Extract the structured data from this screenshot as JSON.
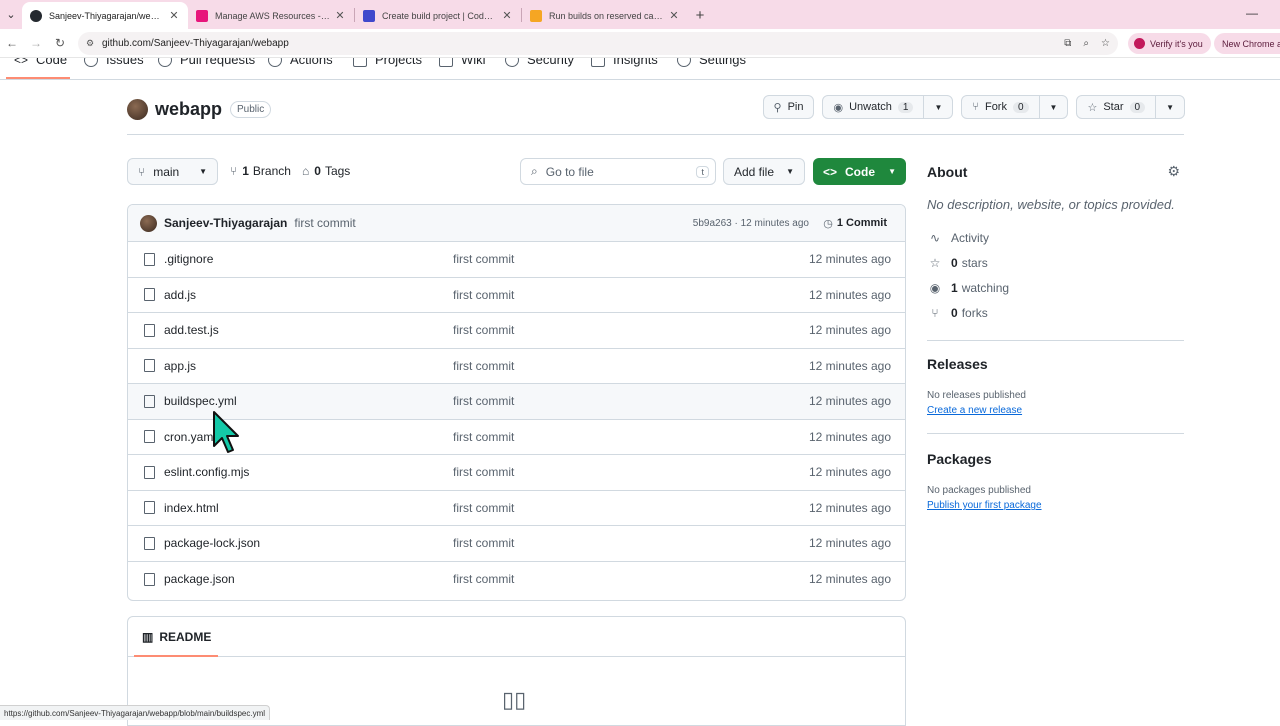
{
  "browser": {
    "tabs": [
      {
        "title": "Sanjeev-Thiyagarajan/webapp",
        "favicon": "github-icon",
        "color": "#24292f"
      },
      {
        "title": "Manage AWS Resources - AWS",
        "favicon": "aws-cube-icon",
        "color": "#e7157b"
      },
      {
        "title": "Create build project | CodeBuild",
        "favicon": "codebuild-icon",
        "color": "#3f48cc"
      },
      {
        "title": "Run builds on reserved capacity",
        "favicon": "aws-docs-icon",
        "color": "#f5a623"
      }
    ],
    "url": "github.com/Sanjeev-Thiyagarajan/webapp",
    "verify_label": "Verify it's you",
    "new_chrome_label": "New Chrome av",
    "status_url": "https://github.com/Sanjeev-Thiyagarajan/webapp/blob/main/buildspec.yml"
  },
  "repo_nav": [
    "Code",
    "Issues",
    "Pull requests",
    "Actions",
    "Projects",
    "Wiki",
    "Security",
    "Insights",
    "Settings"
  ],
  "repo": {
    "name": "webapp",
    "visibility": "Public",
    "pin_label": "Pin",
    "unwatch_label": "Unwatch",
    "unwatch_count": "1",
    "fork_label": "Fork",
    "fork_count": "0",
    "star_label": "Star",
    "star_count": "0"
  },
  "toolbar": {
    "branch": "main",
    "branch_count": "1",
    "branch_label": "Branch",
    "tag_count": "0",
    "tag_label": "Tags",
    "goto_placeholder": "Go to file",
    "goto_key": "t",
    "add_file": "Add file",
    "code_label": "Code"
  },
  "latest_commit": {
    "author": "Sanjeev-Thiyagarajan",
    "message": "first commit",
    "hash_time": "5b9a263 · 12 minutes ago",
    "commits_label": "1 Commit"
  },
  "files": [
    {
      "name": ".gitignore",
      "message": "first commit",
      "time": "12 minutes ago"
    },
    {
      "name": "add.js",
      "message": "first commit",
      "time": "12 minutes ago"
    },
    {
      "name": "add.test.js",
      "message": "first commit",
      "time": "12 minutes ago"
    },
    {
      "name": "app.js",
      "message": "first commit",
      "time": "12 minutes ago"
    },
    {
      "name": "buildspec.yml",
      "message": "first commit",
      "time": "12 minutes ago"
    },
    {
      "name": "cron.yaml",
      "message": "first commit",
      "time": "12 minutes ago"
    },
    {
      "name": "eslint.config.mjs",
      "message": "first commit",
      "time": "12 minutes ago"
    },
    {
      "name": "index.html",
      "message": "first commit",
      "time": "12 minutes ago"
    },
    {
      "name": "package-lock.json",
      "message": "first commit",
      "time": "12 minutes ago"
    },
    {
      "name": "package.json",
      "message": "first commit",
      "time": "12 minutes ago"
    }
  ],
  "readme": {
    "label": "README"
  },
  "about": {
    "title": "About",
    "description": "No description, website, or topics provided.",
    "activity": "Activity",
    "stars_count": "0",
    "stars_label": "stars",
    "watching_count": "1",
    "watching_label": "watching",
    "forks_count": "0",
    "forks_label": "forks"
  },
  "releases": {
    "title": "Releases",
    "text": "No releases published",
    "link": "Create a new release"
  },
  "packages": {
    "title": "Packages",
    "text": "No packages published",
    "link": "Publish your first package"
  },
  "colors": {
    "tab_strip": "#f7dbe8",
    "code_button": "#1f883d",
    "link": "#0969da",
    "accent_underline": "#fd8c73",
    "cursor": "#14c9a8"
  }
}
